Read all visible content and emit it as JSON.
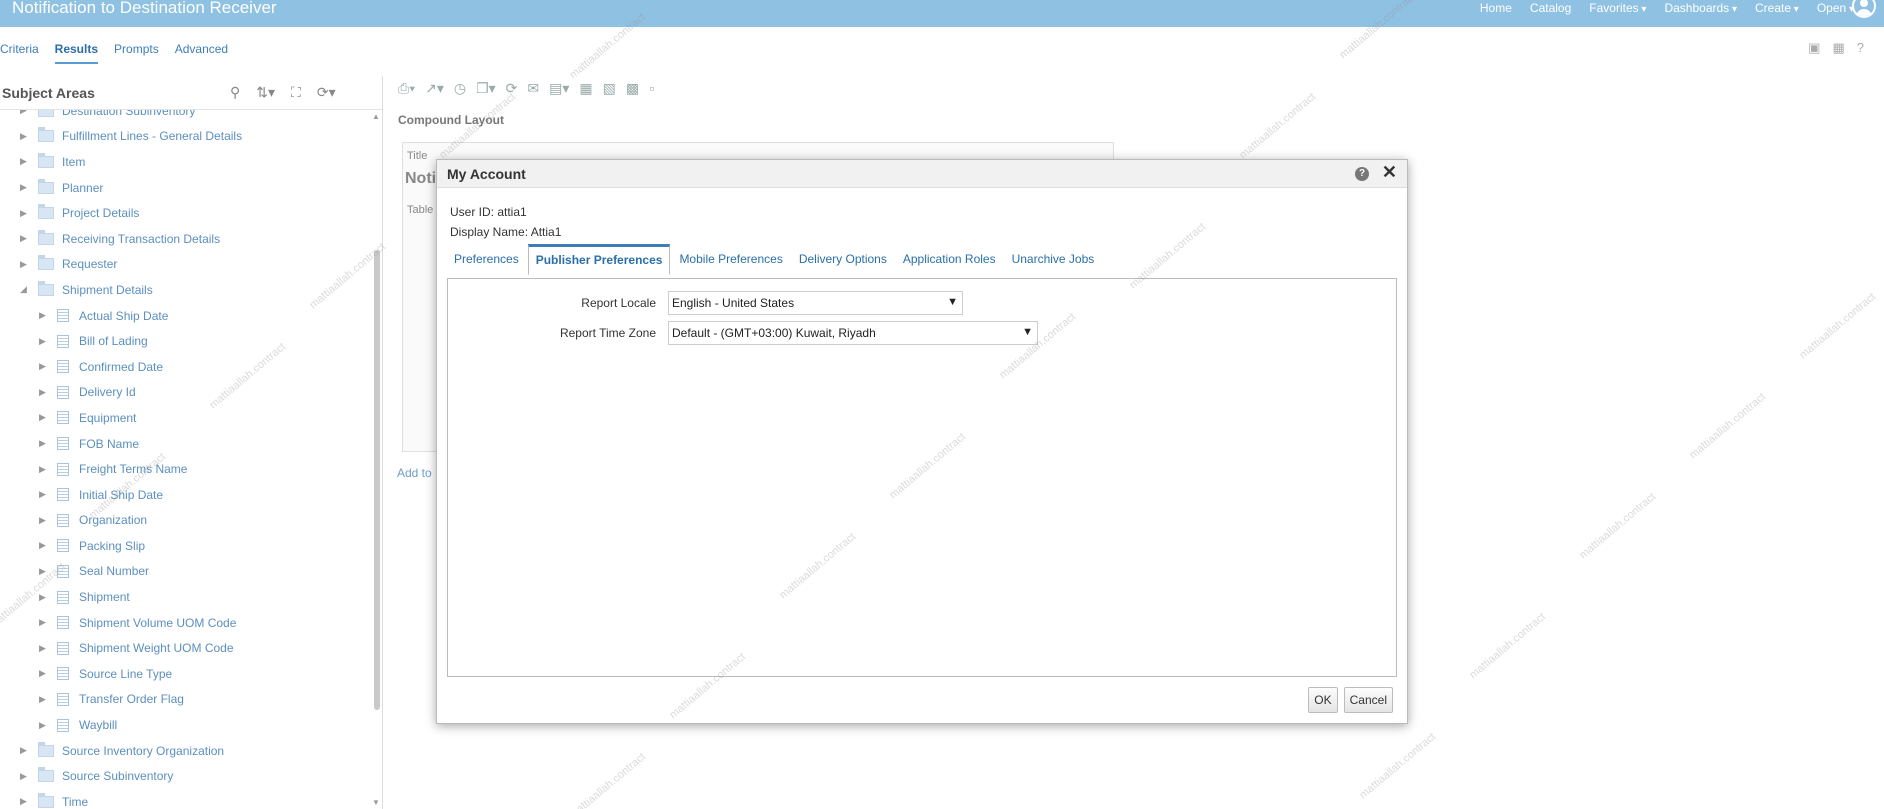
{
  "app": {
    "title": "Notification to Destination Receiver",
    "nav": [
      "Home",
      "Catalog",
      "Favorites",
      "Dashboards",
      "Create",
      "Open"
    ]
  },
  "subtabs": [
    "Criteria",
    "Results",
    "Prompts",
    "Advanced"
  ],
  "left_panel": {
    "header": "Subject Areas",
    "items": [
      {
        "label": "Destination Subinventory",
        "level": 1,
        "type": "folder"
      },
      {
        "label": "Fulfillment Lines - General Details",
        "level": 1,
        "type": "folder"
      },
      {
        "label": "Item",
        "level": 1,
        "type": "folder"
      },
      {
        "label": "Planner",
        "level": 1,
        "type": "folder"
      },
      {
        "label": "Project Details",
        "level": 1,
        "type": "folder"
      },
      {
        "label": "Receiving Transaction Details",
        "level": 1,
        "type": "folder"
      },
      {
        "label": "Requester",
        "level": 1,
        "type": "folder"
      },
      {
        "label": "Shipment Details",
        "level": 1,
        "type": "folder",
        "expanded": true
      },
      {
        "label": "Actual Ship Date",
        "level": 2,
        "type": "column"
      },
      {
        "label": "Bill of Lading",
        "level": 2,
        "type": "column"
      },
      {
        "label": "Confirmed Date",
        "level": 2,
        "type": "column"
      },
      {
        "label": "Delivery Id",
        "level": 2,
        "type": "column"
      },
      {
        "label": "Equipment",
        "level": 2,
        "type": "column"
      },
      {
        "label": "FOB Name",
        "level": 2,
        "type": "column"
      },
      {
        "label": "Freight Terms Name",
        "level": 2,
        "type": "column"
      },
      {
        "label": "Initial Ship Date",
        "level": 2,
        "type": "column"
      },
      {
        "label": "Organization",
        "level": 2,
        "type": "column"
      },
      {
        "label": "Packing Slip",
        "level": 2,
        "type": "column"
      },
      {
        "label": "Seal Number",
        "level": 2,
        "type": "column"
      },
      {
        "label": "Shipment",
        "level": 2,
        "type": "column"
      },
      {
        "label": "Shipment Volume UOM Code",
        "level": 2,
        "type": "column"
      },
      {
        "label": "Shipment Weight UOM Code",
        "level": 2,
        "type": "column"
      },
      {
        "label": "Source Line Type",
        "level": 2,
        "type": "column"
      },
      {
        "label": "Transfer Order Flag",
        "level": 2,
        "type": "column"
      },
      {
        "label": "Waybill",
        "level": 2,
        "type": "column"
      },
      {
        "label": "Source Inventory Organization",
        "level": 1,
        "type": "folder"
      },
      {
        "label": "Source Subinventory",
        "level": 1,
        "type": "folder"
      },
      {
        "label": "Time",
        "level": 1,
        "type": "folder"
      }
    ]
  },
  "main": {
    "compound_layout": "Compound Layout",
    "bg_title_label": "Title",
    "bg_title": "Noti",
    "bg_table_label": "Table",
    "bg_add": "Add to"
  },
  "dialog": {
    "title": "My Account",
    "user_id": "User ID: attia1",
    "display_name": "Display Name: Attia1",
    "tabs": [
      "Preferences",
      "Publisher Preferences",
      "Mobile Preferences",
      "Delivery Options",
      "Application Roles",
      "Unarchive Jobs"
    ],
    "active_tab": "Publisher Preferences",
    "fields": {
      "report_locale_label": "Report Locale",
      "report_locale_value": "English - United States",
      "report_tz_label": "Report Time Zone",
      "report_tz_value": "Default - (GMT+03:00) Kuwait, Riyadh"
    },
    "ok": "OK",
    "cancel": "Cancel"
  },
  "watermark": "mattiaallah.contract"
}
